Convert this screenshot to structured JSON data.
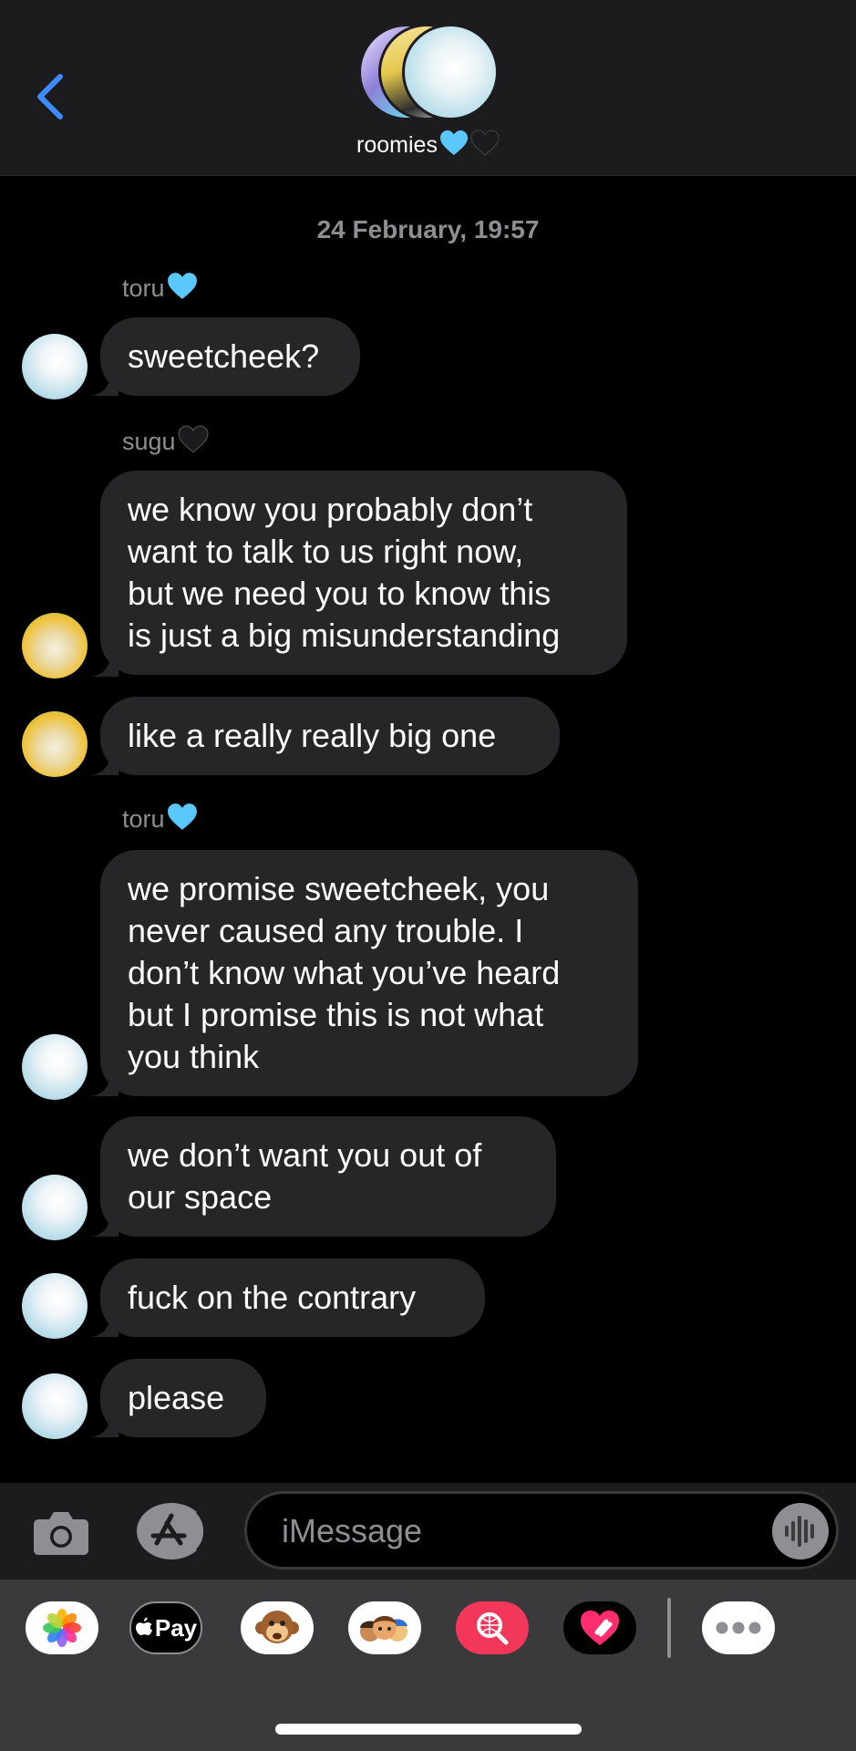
{
  "header": {
    "group_name": "roomies",
    "back_icon": "chevron-left-icon",
    "accent": "#3d8bfd"
  },
  "conversation": {
    "timestamp": "24 February, 19:57",
    "senders": {
      "toru_name": "toru",
      "toru_heart_color": "#5ac8fa",
      "sugu_name": "sugu",
      "sugu_heart_color": "#1c1c1e"
    },
    "messages": [
      {
        "from": "toru",
        "text": "sweetcheek?"
      },
      {
        "from": "sugu",
        "text": "we know you probably don’t\nwant to talk to us right now,\nbut we need you to know this\nis just a big misunderstanding"
      },
      {
        "from": "sugu",
        "text": "like a really really big one"
      },
      {
        "from": "toru",
        "text": "we promise sweetcheek, you\nnever caused any trouble. I\ndon’t know what you’ve heard\nbut I promise this is not what\nyou think"
      },
      {
        "from": "toru",
        "text": "we don’t want you out of\nour space"
      },
      {
        "from": "toru",
        "text": "fuck on the contrary"
      },
      {
        "from": "toru",
        "text": "please"
      }
    ],
    "bubble_color": "#262629"
  },
  "composer": {
    "placeholder": "iMessage",
    "camera_icon": "camera-icon",
    "apps_icon": "app-store-icon",
    "voice_icon": "waveform-icon"
  },
  "app_tray": {
    "apple_pay_label": "Pay",
    "items": [
      "photos-icon",
      "apple-pay-icon",
      "animoji-icon",
      "memoji-icon",
      "image-search-icon",
      "digital-touch-icon",
      "more-icon"
    ]
  }
}
